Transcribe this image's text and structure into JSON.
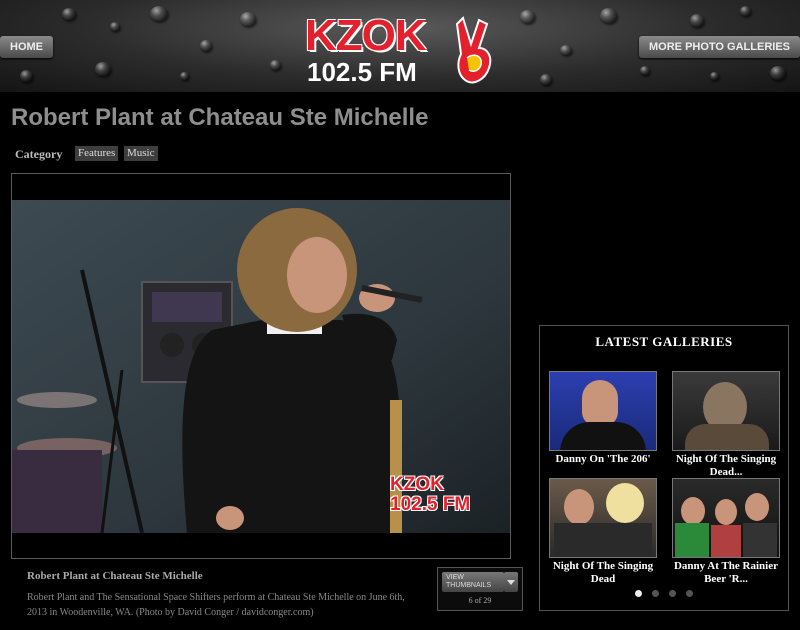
{
  "header": {
    "home_label": "HOME",
    "more_label": "MORE PHOTO GALLERIES",
    "logo": {
      "call_sign": "KZOK",
      "frequency": "102.5 FM"
    }
  },
  "gallery": {
    "title": "Robert Plant at Chateau Ste Michelle",
    "category_label": "Category",
    "categories": [
      "Features",
      "Music"
    ],
    "photo": {
      "watermark": "KZOK 102.5 FM",
      "caption_title": "Robert Plant at Chateau Ste Michelle",
      "caption_text": "Robert Plant and The Sensational Space Shifters perform at Chateau Ste Michelle on June 6th, 2013 in Woodenville, WA. (Photo by David Conger / davidconger.com)"
    },
    "thumbnails_button": "VIEW THUMBNAILS",
    "counter": "6 of 29"
  },
  "latest": {
    "title": "LATEST GALLERIES",
    "items": [
      {
        "label": "Danny On 'The 206'"
      },
      {
        "label": "Night Of The Singing Dead..."
      },
      {
        "label": "Night Of The Singing Dead"
      },
      {
        "label": "Danny At The Rainier Beer 'R..."
      }
    ],
    "pager": {
      "pages": 4,
      "active": 1
    }
  },
  "colors": {
    "brand_red": "#e3202b",
    "background": "#000000",
    "title_gray": "#8e8e8e"
  }
}
